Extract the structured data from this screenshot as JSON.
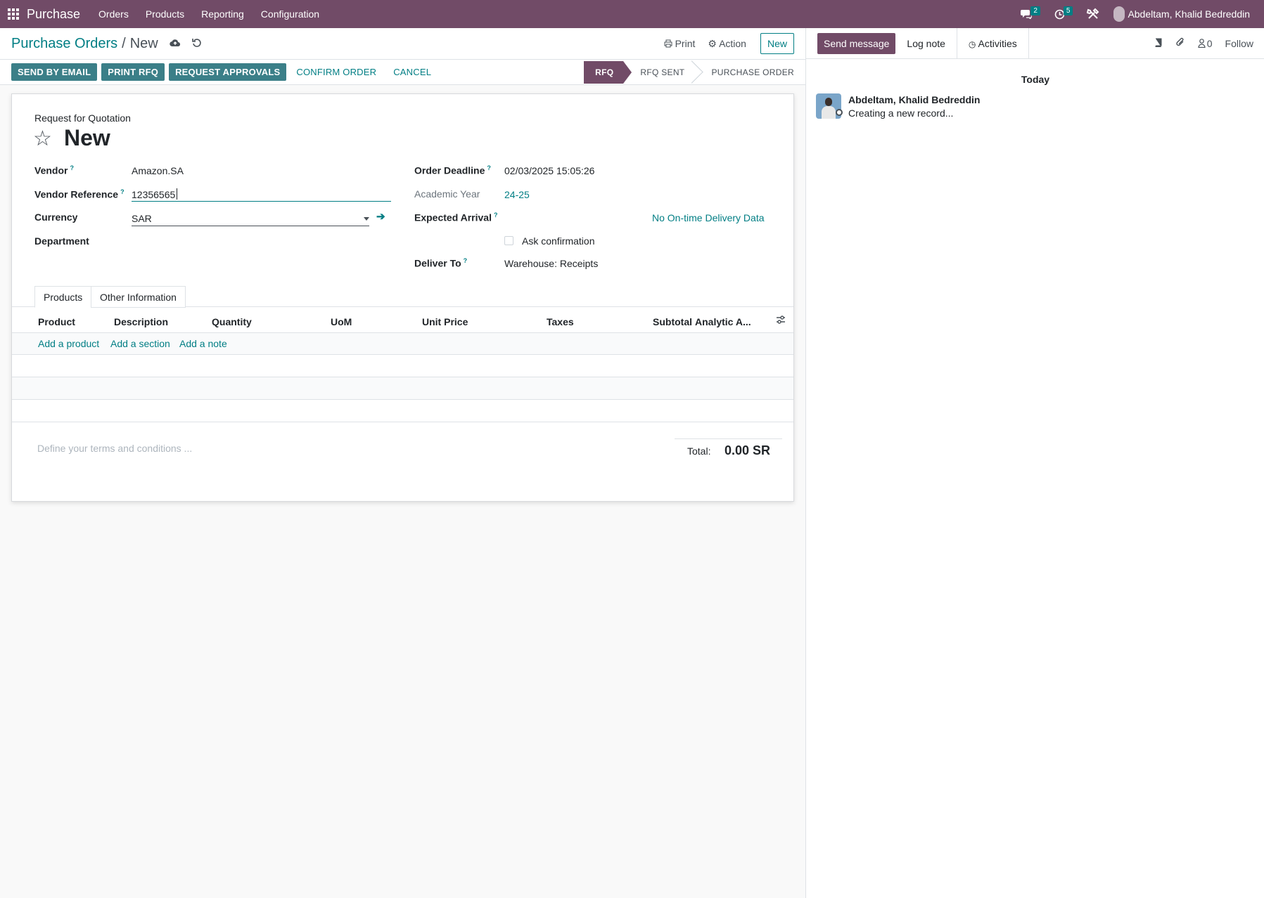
{
  "navbar": {
    "app_name": "Purchase",
    "menu": [
      "Orders",
      "Products",
      "Reporting",
      "Configuration"
    ],
    "messages_count": "2",
    "activities_count": "5",
    "user_name": "Abdeltam, Khalid Bedreddin"
  },
  "control_panel": {
    "breadcrumb_parent": "Purchase Orders",
    "breadcrumb_sep": "/",
    "breadcrumb_current": "New",
    "print_label": "Print",
    "action_label": "Action",
    "new_label": "New"
  },
  "statusbar": {
    "buttons": [
      "SEND BY EMAIL",
      "PRINT RFQ",
      "REQUEST APPROVALS"
    ],
    "links": [
      "CONFIRM ORDER",
      "CANCEL"
    ],
    "stages": [
      "RFQ",
      "RFQ SENT",
      "PURCHASE ORDER"
    ],
    "active_stage": "RFQ"
  },
  "form": {
    "subtitle": "Request for Quotation",
    "name": "New",
    "help_mark": "?",
    "left": {
      "vendor_label": "Vendor",
      "vendor_value": "Amazon.SA",
      "vendor_ref_label": "Vendor Reference",
      "vendor_ref_value": "12356565",
      "currency_label": "Currency",
      "currency_value": "SAR",
      "department_label": "Department"
    },
    "right": {
      "deadline_label": "Order Deadline",
      "deadline_value": "02/03/2025 15:05:26",
      "academic_label": "Academic Year",
      "academic_value": "24-25",
      "expected_label": "Expected Arrival",
      "ontime_value": "No On-time Delivery Data",
      "ask_confirmation_label": "Ask confirmation",
      "deliver_label": "Deliver To",
      "deliver_value": "Warehouse: Receipts"
    },
    "tabs": [
      "Products",
      "Other Information"
    ],
    "columns": [
      "Product",
      "Description",
      "Quantity",
      "UoM",
      "Unit Price",
      "Taxes",
      "Subtotal",
      "Analytic A..."
    ],
    "add_links": [
      "Add a product",
      "Add a section",
      "Add a note"
    ],
    "terms_placeholder": "Define your terms and conditions ...",
    "total_label": "Total:",
    "total_value": "0.00 SR"
  },
  "chatter": {
    "send_message": "Send message",
    "log_note": "Log note",
    "activities": "Activities",
    "followers_count": "0",
    "follow": "Follow",
    "date_separator": "Today",
    "message_author": "Abdeltam, Khalid Bedreddin",
    "message_body": "Creating a new record..."
  },
  "colors": {
    "brand": "#714b67",
    "accent": "#017e84",
    "action_button": "#3b7f88"
  }
}
